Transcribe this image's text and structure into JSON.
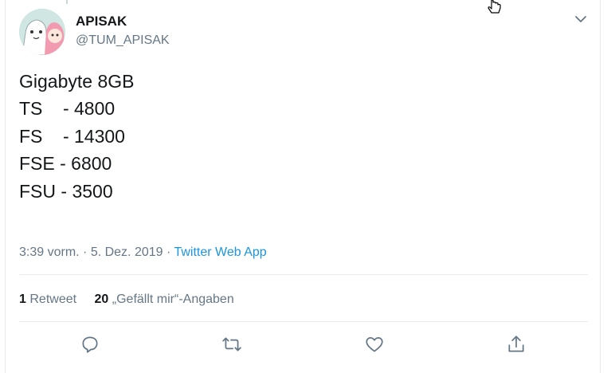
{
  "user": {
    "name": "APISAK",
    "handle": "@TUM_APISAK"
  },
  "tweet": {
    "lines": [
      "Gigabyte 8GB",
      "",
      "TS    - 4800",
      "FS    - 14300",
      "FSE - 6800",
      "FSU - 3500"
    ]
  },
  "meta": {
    "time": "3:39 vorm.",
    "separator": " · ",
    "date": "5. Dez. 2019",
    "source": "Twitter Web App"
  },
  "stats": {
    "retweets_count": "1",
    "retweets_label": "Retweet",
    "likes_count": "20",
    "likes_label": "„Gefällt mir“-Angaben"
  },
  "icons": {
    "reply": "reply-icon",
    "retweet": "retweet-icon",
    "like": "heart-icon",
    "share": "share-icon",
    "menu": "chevron-down-icon"
  },
  "colors": {
    "link": "#1b95e0",
    "secondary": "#657786",
    "text": "#14171a",
    "border": "#e6ecf0"
  }
}
